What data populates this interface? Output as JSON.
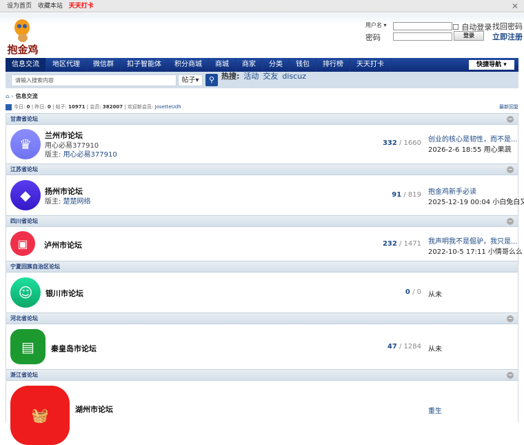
{
  "topbar": {
    "set_home": "设为首页",
    "bookmark": "收藏本站",
    "checkin": "天天打卡"
  },
  "logo": {
    "text": "抱金鸡"
  },
  "login": {
    "username_label": "用户名",
    "password_label": "密码",
    "auto_login": "自动登录",
    "forgot": "找回密码",
    "login_btn": "登录",
    "register": "立即注册"
  },
  "nav": {
    "items": [
      "信息交流",
      "地区代理",
      "微信群",
      "扣子智能体",
      "积分商城",
      "商城",
      "商家",
      "分类",
      "钱包",
      "排行榜",
      "天天打卡"
    ],
    "quick": "快捷导航"
  },
  "search": {
    "placeholder": "请输入搜索内容",
    "type": "帖子",
    "hot_label": "热搜:",
    "hot": [
      "活动",
      "交友",
      "discuz"
    ]
  },
  "breadcrumb": {
    "current": "信息交流"
  },
  "stats": {
    "today_label": "今日:",
    "today": "0",
    "yesterday_label": "昨日:",
    "yesterday": "0",
    "posts_label": "帖子:",
    "posts": "10971",
    "members_label": "会员:",
    "members": "382007",
    "welcome_label": "欢迎新会员:",
    "new_member": "JosetteUdh",
    "latest_reply": "最新回复"
  },
  "sections": [
    {
      "title": "甘肃省论坛",
      "forum": {
        "name": "兰州市论坛",
        "desc": "用心必易377910",
        "mod_label": "版主:",
        "mod": "用心必易377910",
        "threads": "332",
        "posts": "1660",
        "last_title": "创业的核心是韧性，而不是...",
        "last_meta": "2026-2-6 18:55 用心果蔬"
      }
    },
    {
      "title": "江苏省论坛",
      "forum": {
        "name": "扬州市论坛",
        "mod_label": "版主:",
        "mod": "楚楚网络",
        "threads": "91",
        "posts": "819",
        "last_title": "抱金鸡新手必读",
        "last_meta": "2025-12-19 00:04 小白兔白又"
      }
    },
    {
      "title": "四川省论坛",
      "forum": {
        "name": "泸州市论坛",
        "threads": "232",
        "posts": "1471",
        "last_title": "我声明我不是倔驴，我只是...",
        "last_meta": "2022-10-5 17:11 小情哥么么"
      }
    },
    {
      "title": "宁夏回族自治区论坛",
      "forum": {
        "name": "银川市论坛",
        "threads": "0",
        "posts": "0",
        "last_meta": "从未"
      }
    },
    {
      "title": "河北省论坛",
      "forum": {
        "name": "秦皇岛市论坛",
        "threads": "47",
        "posts": "1284",
        "last_meta": "从未"
      }
    },
    {
      "title": "浙江省论坛",
      "forum": {
        "name": "湖州市论坛",
        "last_title": "重生"
      }
    }
  ]
}
